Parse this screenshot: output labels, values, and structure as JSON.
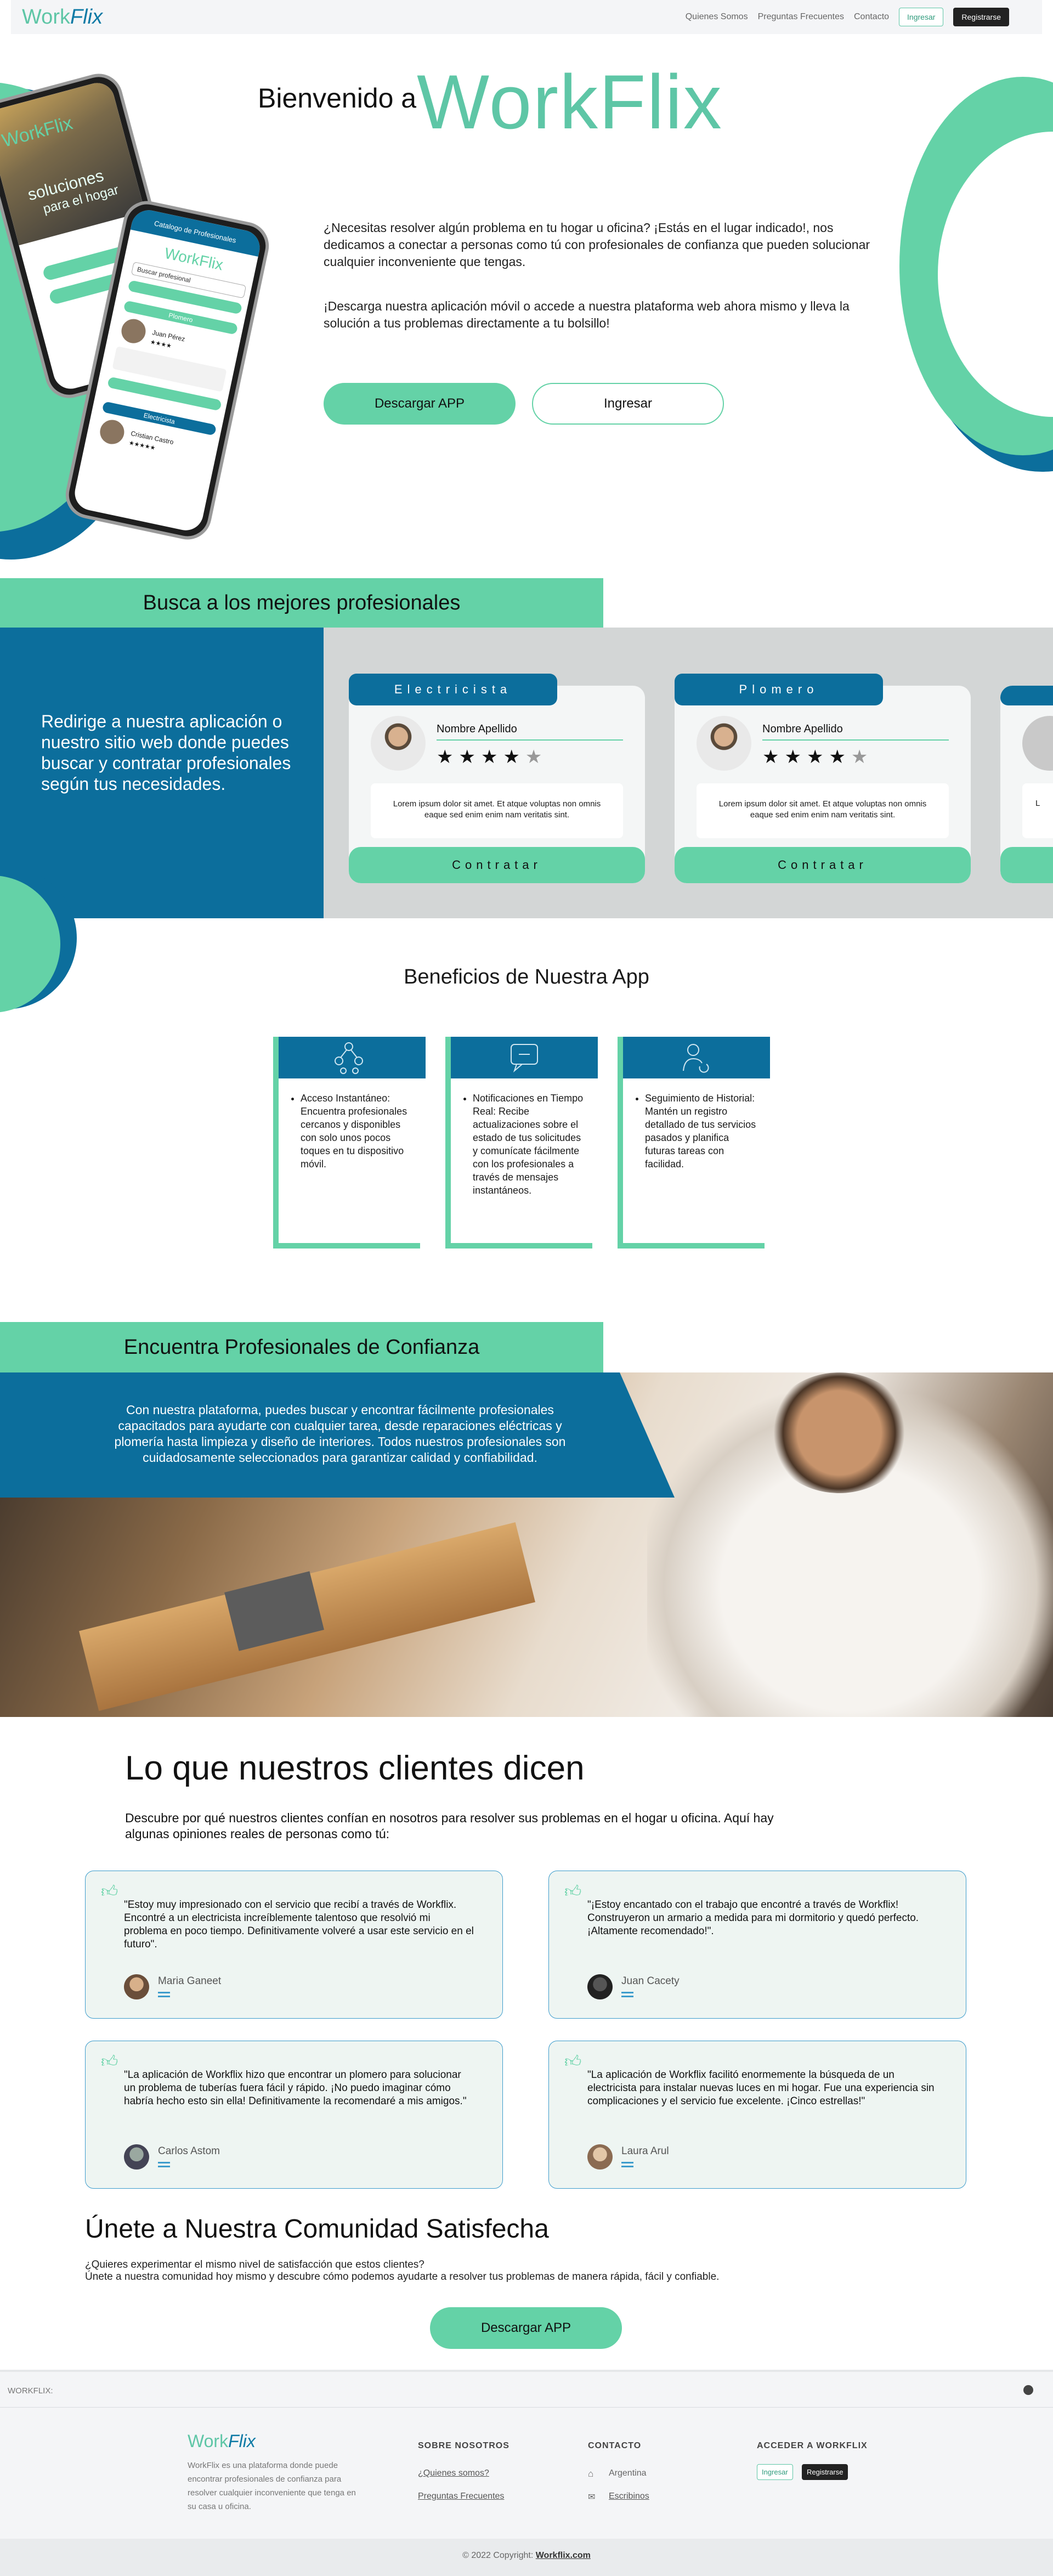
{
  "nav": {
    "brand_main": "Work",
    "brand_x": "Flix",
    "links": [
      "Quienes Somos",
      "Preguntas Frecuentes",
      "Contacto"
    ],
    "login_label": "Ingresar",
    "register_label": "Registrarse"
  },
  "hero": {
    "welcome": "Bienvenido a",
    "brand": "WorkFlix",
    "paragraph1": "¿Necesitas resolver algún problema en tu hogar u oficina? ¡Estás en el lugar indicado!, nos dedicamos a conectar a personas como tú con profesionales de confianza que pueden solucionar cualquier inconveniente que tengas.",
    "paragraph2": "¡Descarga nuestra aplicación móvil o accede a nuestra plataforma web ahora mismo y lleva la solución a tus problemas directamente a tu bolsillo!",
    "download_label": "Descargar APP",
    "login_label": "Ingresar"
  },
  "phones": {
    "back_brand": "WorkFlix",
    "back_text1": "soluciones",
    "back_text2": "para el hogar",
    "front_header": "Catalogo de Profesionales",
    "front_brand": "WorkFlix",
    "front_search": "Buscar profesional",
    "front_cat1": "Plomero",
    "front_name": "Juan Pérez",
    "front_cat2": "Electricista",
    "front_name2": "Cristian Castro"
  },
  "search": {
    "title": "Busca a los mejores profesionales",
    "side_text": "Redirige a nuestra aplicación o nuestro sitio web donde puedes buscar y contratar profesionales según tus necesidades.",
    "cards": [
      {
        "category": "Electricista",
        "name": "Nombre Apellido",
        "desc": "Lorem ipsum dolor sit amet. Et atque voluptas non omnis eaque sed enim enim nam veritatis sint.",
        "button": "Contratar",
        "rating": 4
      },
      {
        "category": "Plomero",
        "name": "Nombre Apellido",
        "desc": "Lorem ipsum dolor sit amet. Et atque voluptas non omnis eaque sed enim enim nam veritatis sint.",
        "button": "Contratar",
        "rating": 4
      },
      {
        "category": "",
        "name": "",
        "desc": "L",
        "button": "",
        "rating": 0
      }
    ]
  },
  "benefits": {
    "title": "Beneficios de Nuestra App",
    "items": [
      {
        "icon": "network-icon",
        "text": "Acceso Instantáneo: Encuentra profesionales cercanos y disponibles con solo unos pocos toques en tu dispositivo móvil."
      },
      {
        "icon": "chat-icon",
        "text": "Notificaciones en Tiempo Real: Recibe actualizaciones sobre el estado de tus solicitudes y comunícate fácilmente con los profesionales a través de mensajes instantáneos."
      },
      {
        "icon": "user-history-icon",
        "text": "Seguimiento de Historial: Mantén un registro detallado de tus servicios pasados y planifica futuras tareas con facilidad."
      }
    ]
  },
  "trust": {
    "title": "Encuentra Profesionales de Confianza",
    "text": "Con nuestra plataforma, puedes buscar y encontrar fácilmente profesionales capacitados para ayudarte con cualquier tarea, desde reparaciones eléctricas y plomería hasta limpieza y diseño de interiores. Todos nuestros profesionales son cuidadosamente seleccionados para garantizar calidad y confiabilidad."
  },
  "testimonials": {
    "title": "Lo que nuestros clientes dicen",
    "subtitle": "Descubre por qué nuestros clientes confían en nosotros para resolver sus problemas en el hogar u oficina. Aquí hay algunas opiniones reales de personas como tú:",
    "items": [
      {
        "quote": "\"Estoy muy impresionado con el servicio que recibí a través de Workflix. Encontré a un electricista increíblemente talentoso que resolvió mi problema en poco tiempo. Definitivamente volveré a usar este servicio en el futuro\".",
        "name": "Maria Ganeet"
      },
      {
        "quote": "\"¡Estoy encantado con el trabajo que encontré a través de Workflix! Construyeron un armario a medida para mi dormitorio y quedó perfecto. ¡Altamente recomendado!\".",
        "name": "Juan Cacety"
      },
      {
        "quote": "\"La aplicación de Workflix hizo que encontrar un plomero para solucionar un problema de tuberías fuera fácil y rápido. ¡No puedo imaginar cómo habría hecho esto sin ella! Definitivamente la recomendaré a mis amigos.\"",
        "name": "Carlos Astom"
      },
      {
        "quote": "\"La aplicación de Workflix facilitó enormemente la búsqueda de un electricista para instalar nuevas luces en mi hogar. Fue una experiencia sin complicaciones y el servicio fue excelente. ¡Cinco estrellas!\"",
        "name": "Laura Arul"
      }
    ]
  },
  "community": {
    "title": "Únete a Nuestra Comunidad Satisfecha",
    "line1": "¿Quieres experimentar el mismo nivel de satisfacción que estos clientes?",
    "line2": "Únete a nuestra comunidad hoy mismo y descubre cómo podemos ayudarte a resolver tus problemas de manera rápida, fácil y confiable.",
    "button": "Descargar APP"
  },
  "footer": {
    "top_label": "WORKFLIX:",
    "brand_main": "Work",
    "brand_x": "Flix",
    "about": "WorkFlix es una plataforma donde puede encontrar profesionales de confianza para resolver cualquier inconveniente que tenga en su casa u oficina.",
    "col1_title": "SOBRE NOSOTROS",
    "col1_links": [
      "¿Quienes somos?",
      "Preguntas Frecuentes"
    ],
    "col2_title": "CONTACTO",
    "col2_items": [
      "Argentina",
      "Escribinos"
    ],
    "col3_title": "ACCEDER A WORKFLIX",
    "login_label": "Ingresar",
    "register_label": "Registrarse",
    "copyright_prefix": "© 2022 Copyright:",
    "copyright_link": "Workflix.com"
  },
  "colors": {
    "green": "#64d2a7",
    "blue": "#0c6e9c",
    "dark": "#222222"
  }
}
